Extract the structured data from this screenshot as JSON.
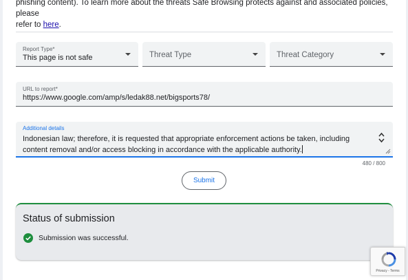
{
  "intro": {
    "line1": "phishing content). To learn more about the threats Safe Browsing protects against and associated policies, please",
    "line2_prefix": "refer to ",
    "link_text": "here",
    "line2_suffix": "."
  },
  "form": {
    "report_type": {
      "label": "Report Type*",
      "value": "This page is not safe"
    },
    "threat_type": {
      "placeholder": "Threat Type"
    },
    "threat_category": {
      "placeholder": "Threat Category"
    },
    "url": {
      "label": "URL to report*",
      "value": "https://www.google.com/amp/s/ledak88.net/bigsports78/"
    },
    "details": {
      "label": "Additional details",
      "line1": "Indonesian law; therefore, it is requested that appropriate enforcement actions be taken, including",
      "line2": "content removal and/or access blocking in accordance with the applicable authority."
    },
    "counter": "480 / 800",
    "submit_label": "Submit"
  },
  "status": {
    "title": "Status of submission",
    "message": "Submission was successful."
  },
  "recaptcha": {
    "links": "Privacy - Terms"
  },
  "colors": {
    "accent": "#1a73e8",
    "success": "#1e8e3e",
    "field_bg": "#f1f3f4"
  }
}
